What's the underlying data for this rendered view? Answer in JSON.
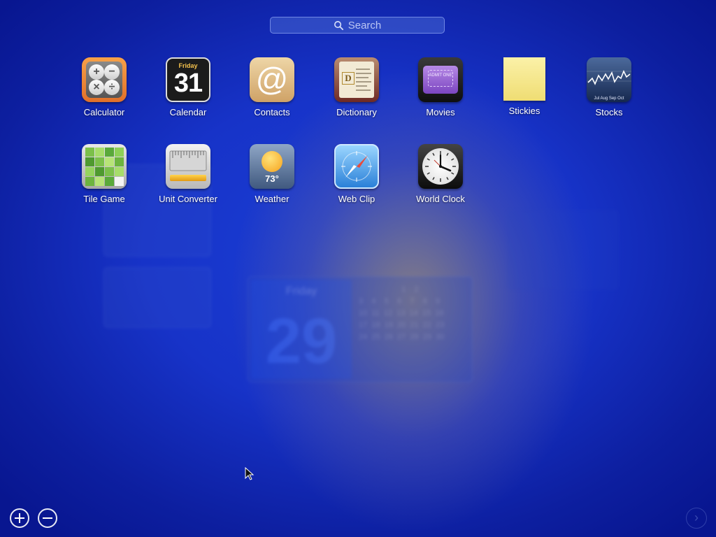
{
  "search": {
    "placeholder": "Search"
  },
  "widgets": [
    {
      "id": "calculator",
      "label": "Calculator"
    },
    {
      "id": "calendar",
      "label": "Calendar",
      "icon_day": "Friday",
      "icon_date": "31"
    },
    {
      "id": "contacts",
      "label": "Contacts",
      "icon_glyph": "@"
    },
    {
      "id": "dictionary",
      "label": "Dictionary",
      "icon_glyph": "D"
    },
    {
      "id": "movies",
      "label": "Movies",
      "icon_text": "ADMIT ONE"
    },
    {
      "id": "stickies",
      "label": "Stickies"
    },
    {
      "id": "stocks",
      "label": "Stocks",
      "icon_months": "Jul  Aug  Sep  Oct"
    },
    {
      "id": "tile-game",
      "label": "Tile Game"
    },
    {
      "id": "unit-converter",
      "label": "Unit Converter"
    },
    {
      "id": "weather",
      "label": "Weather",
      "icon_temp": "73°"
    },
    {
      "id": "web-clip",
      "label": "Web Clip"
    },
    {
      "id": "world-clock",
      "label": "World Clock"
    }
  ],
  "calculator_keys": [
    "+",
    "−",
    "×",
    "÷"
  ],
  "background_calendar": {
    "day": "Friday",
    "date": "29",
    "grid_rows": [
      "                    1    2",
      "3    4    5    6    7    8    9",
      "10  11  12  13  14  15  16",
      "17  18  19  20  21  22  23",
      "24  25  26  27  28  29  30"
    ]
  },
  "controls": {
    "add": "+",
    "remove": "−",
    "next": "›"
  },
  "colors": {
    "background": "#1733c8",
    "label": "#ffffff"
  }
}
